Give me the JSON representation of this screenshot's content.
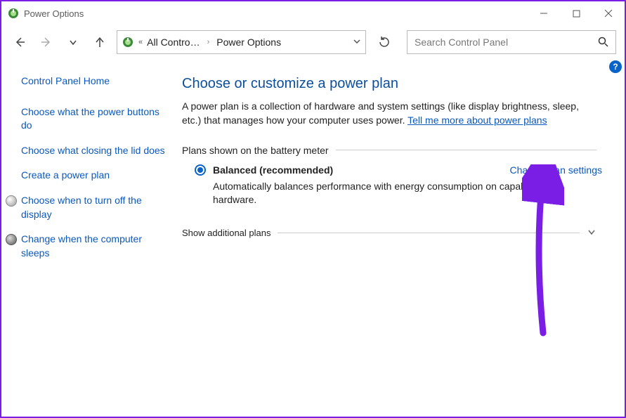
{
  "window": {
    "title": "Power Options"
  },
  "breadcrumb": {
    "root": "All Contro…",
    "current": "Power Options"
  },
  "search": {
    "placeholder": "Search Control Panel"
  },
  "sidebar": {
    "home": "Control Panel Home",
    "items": [
      "Choose what the power buttons do",
      "Choose what closing the lid does",
      "Create a power plan",
      "Choose when to turn off the display",
      "Change when the computer sleeps"
    ]
  },
  "main": {
    "title": "Choose or customize a power plan",
    "desc_pre": "A power plan is a collection of hardware and system settings (like display brightness, sleep, etc.) that manages how your computer uses power. ",
    "desc_link": "Tell me more about power plans",
    "plans_label": "Plans shown on the battery meter",
    "plan": {
      "name": "Balanced (recommended)",
      "change_link": "Change plan settings",
      "desc": "Automatically balances performance with energy consumption on capable hardware."
    },
    "expander_label": "Show additional plans"
  },
  "help": {
    "symbol": "?"
  }
}
